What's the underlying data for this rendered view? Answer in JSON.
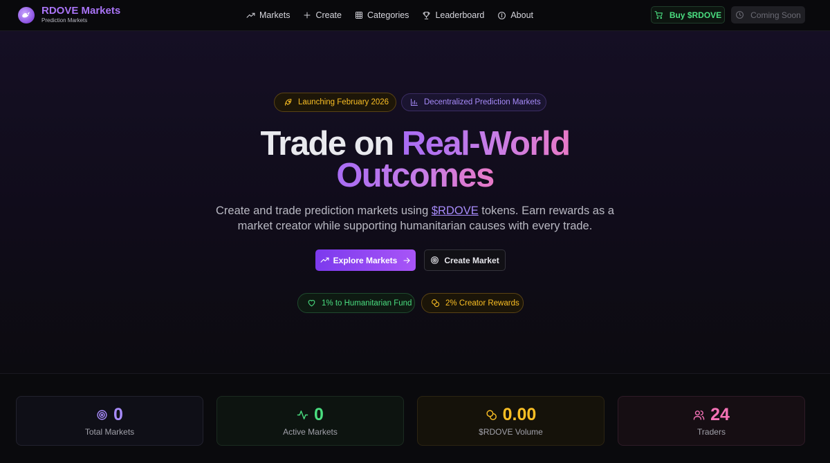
{
  "nav": {
    "brand_title": "RDOVE Markets",
    "brand_subtitle": "Prediction Markets",
    "links": [
      {
        "label": "Markets",
        "icon": "trending-up-icon"
      },
      {
        "label": "Create",
        "icon": "plus-icon"
      },
      {
        "label": "Categories",
        "icon": "grid-icon"
      },
      {
        "label": "Leaderboard",
        "icon": "trophy-icon"
      },
      {
        "label": "About",
        "icon": "info-icon"
      }
    ],
    "buy_label": "Buy $RDOVE",
    "soon_label": "Coming Soon"
  },
  "hero": {
    "badge_launch": "Launching February 2026",
    "badge_dpm": "Decentralized Prediction Markets",
    "headline_white": "Trade on",
    "headline_accent_1": "Real-World",
    "headline_accent_2": "Outcomes",
    "sub_before": "Create and trade prediction markets using ",
    "sub_token": "$RDOVE",
    "sub_after": " tokens. Earn rewards as a market creator while supporting humanitarian causes with every trade.",
    "explore_label": "Explore Markets",
    "create_label": "Create Market",
    "badge_fund": "1% to Humanitarian Fund",
    "badge_creator": "2% Creator Rewards"
  },
  "stats": [
    {
      "value": "0",
      "label": "Total Markets",
      "icon": "target-icon",
      "color": "#a78bfa"
    },
    {
      "value": "0",
      "label": "Active Markets",
      "icon": "activity-icon",
      "color": "#4ade80"
    },
    {
      "value": "0.00",
      "label": "$RDOVE Volume",
      "icon": "coins-icon",
      "color": "#fbbf24"
    },
    {
      "value": "24",
      "label": "Traders",
      "icon": "users-icon",
      "color": "#f472b6"
    }
  ],
  "colors": {
    "accent_purple": "#a78bfa",
    "accent_green": "#4ade80",
    "accent_amber": "#fbbf24",
    "accent_pink": "#f472b6",
    "background": "#0b0a10"
  }
}
